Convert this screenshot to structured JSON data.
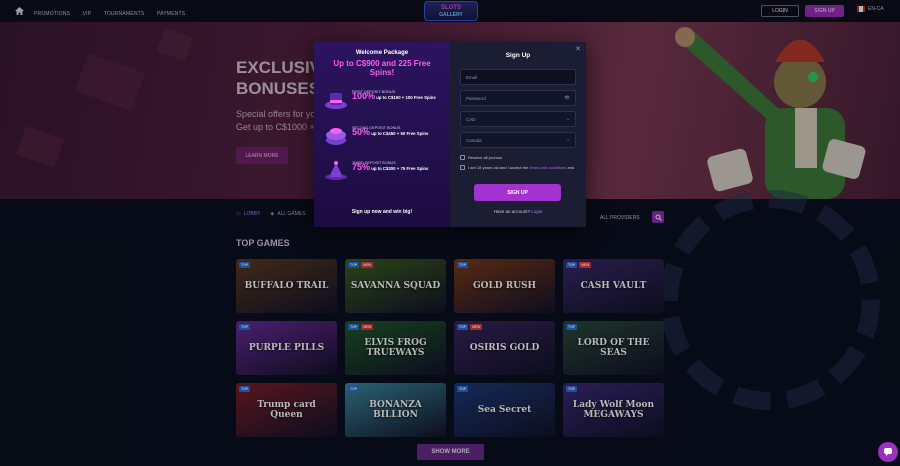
{
  "header": {
    "nav": [
      "PROMOTIONS",
      "VIP",
      "TOURNAMENTS",
      "PAYMENTS"
    ],
    "logo_line1": "SLOTS",
    "logo_line2": "GALLERY",
    "login": "LOGIN",
    "signup": "SIGN UP",
    "lang": "EN-CA"
  },
  "hero": {
    "title_line1": "EXCLUSIV",
    "title_line2": "BONUSES",
    "sub_line1": "Special offers for yo",
    "sub_line2": "Get up to C$1000 +",
    "button": "LEARN MORE"
  },
  "lobby": {
    "tabs": [
      "LOBBY",
      "ALL GAMES"
    ],
    "providers": "ALL PROVIDERS",
    "section_title": "TOP GAMES",
    "show_more": "SHOW MORE",
    "games": [
      {
        "name": "BUFFALO TRAIL",
        "badges": [
          "TOP"
        ],
        "bg": "#5a3a20"
      },
      {
        "name": "SAVANNA SQUAD",
        "badges": [
          "TOP",
          "NEW"
        ],
        "bg": "#3b5f1f"
      },
      {
        "name": "GOLD RUSH",
        "badges": [
          "TOP"
        ],
        "bg": "#7a3a1a"
      },
      {
        "name": "CASH VAULT",
        "badges": [
          "TOP",
          "NEW"
        ],
        "bg": "#3a2a6a"
      },
      {
        "name": "PURPLE PILLS",
        "badges": [
          "TOP"
        ],
        "bg": "#6a2a9a"
      },
      {
        "name": "ELVIS FROG TRUEWAYS",
        "badges": [
          "TOP",
          "NEW"
        ],
        "bg": "#1e5a2a"
      },
      {
        "name": "OSIRIS GOLD",
        "badges": [
          "TOP",
          "NEW"
        ],
        "bg": "#3a2460"
      },
      {
        "name": "LORD OF THE SEAS",
        "badges": [
          "TOP"
        ],
        "bg": "#2a4a3a"
      },
      {
        "name": "Trump card Queen",
        "badges": [
          "TOP"
        ],
        "bg": "#7a1e2a"
      },
      {
        "name": "BONANZA BILLION",
        "badges": [
          "TOP"
        ],
        "bg": "#3a8aa0"
      },
      {
        "name": "Sea Secret",
        "badges": [
          "TOP"
        ],
        "bg": "#1e3a7a"
      },
      {
        "name": "Lady Wolf Moon MEGAWAYS",
        "badges": [
          "TOP"
        ],
        "bg": "#3a2a7a"
      }
    ]
  },
  "promo": {
    "heading": "Welcome Package",
    "headline": "Up to C$900 and 225 Free Spins!",
    "bonuses": [
      {
        "label": "FIRST DEPOSIT BONUS",
        "pct": "100%",
        "text": "up to C$150 + 100 Free Spins"
      },
      {
        "label": "SECOND DEPOSIT BONUS",
        "pct": "50%",
        "text": "up to C$450 + 50 Free Spins"
      },
      {
        "label": "THIRD DEPOSIT BONUS",
        "pct": "75%",
        "text": "up to C$300 + 75 Free Spins"
      }
    ],
    "footer": "Sign up now and win big!"
  },
  "signup_form": {
    "title": "Sign Up",
    "email_placeholder": "Email",
    "password_placeholder": "Password",
    "currency": "CAD",
    "country": "Canada",
    "check_promos": "Receive all promos",
    "check_terms_prefix": "I am 18 years old and I accept the",
    "check_terms_link": "terms and conditions",
    "check_terms_suffix": "and",
    "button": "SIGN UP",
    "have_account": "Have an account?",
    "login_link": "Login"
  }
}
